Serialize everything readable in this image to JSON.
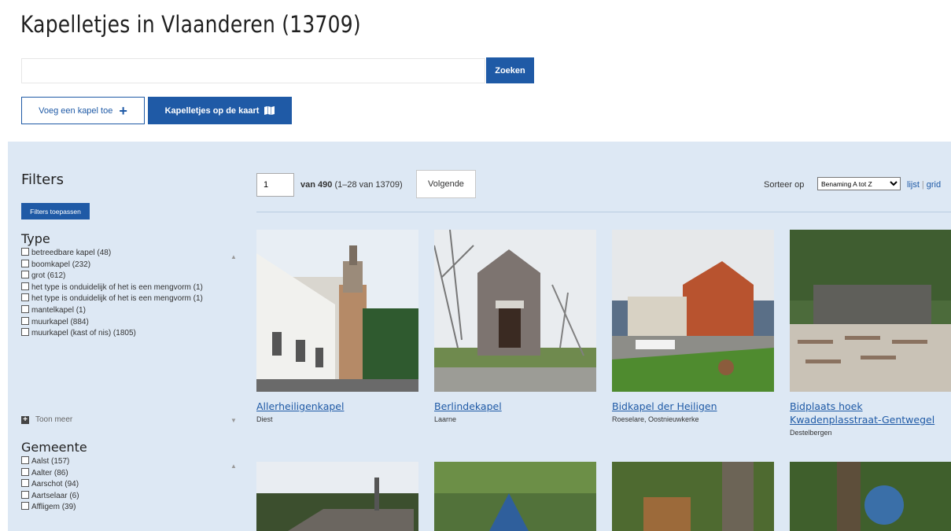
{
  "title": "Kapelletjes in Vlaanderen (13709)",
  "search": {
    "value": "",
    "placeholder": "",
    "button_label": "Zoeken"
  },
  "actions": {
    "add_label": "Voeg een kapel toe",
    "map_label": "Kapelletjes op de kaart"
  },
  "filters": {
    "heading": "Filters",
    "apply_label": "Filters toepassen",
    "type": {
      "heading": "Type",
      "items": [
        "betreedbare kapel (48)",
        "boomkapel (232)",
        "grot (612)",
        "het type is onduidelijk of het is een mengvorm (1)",
        "het type is onduidelijk of het is een mengvorm (1)",
        "mantelkapel (1)",
        "muurkapel (884)",
        "muurkapel (kast of nis) (1805)"
      ],
      "show_more": "Toon meer"
    },
    "gemeente": {
      "heading": "Gemeente",
      "items": [
        "Aalst (157)",
        "Aalter (86)",
        "Aarschot (94)",
        "Aartselaar (6)",
        "Affligem (39)"
      ]
    }
  },
  "pagination": {
    "current_page": "1",
    "of_label": "van 490",
    "range": "(1–28 van 13709)",
    "next_label": "Volgende"
  },
  "sort": {
    "label": "Sorteer op",
    "selected": "Benaming A tot Z"
  },
  "view": {
    "list_label": "lijst",
    "grid_label": "grid"
  },
  "results": [
    {
      "title": "Allerheiligenkapel",
      "place": "Diest"
    },
    {
      "title": "Berlindekapel",
      "place": "Laarne"
    },
    {
      "title": "Bidkapel der Heiligen",
      "place": "Roeselare, Oostnieuwkerke"
    },
    {
      "title": "Bidplaats hoek Kwadenplasstraat-Gentwegel",
      "place": "Destelbergen"
    }
  ],
  "colors": {
    "accent": "#1f5aa6",
    "panel": "#dde8f4",
    "link": "#1f5aa6"
  }
}
